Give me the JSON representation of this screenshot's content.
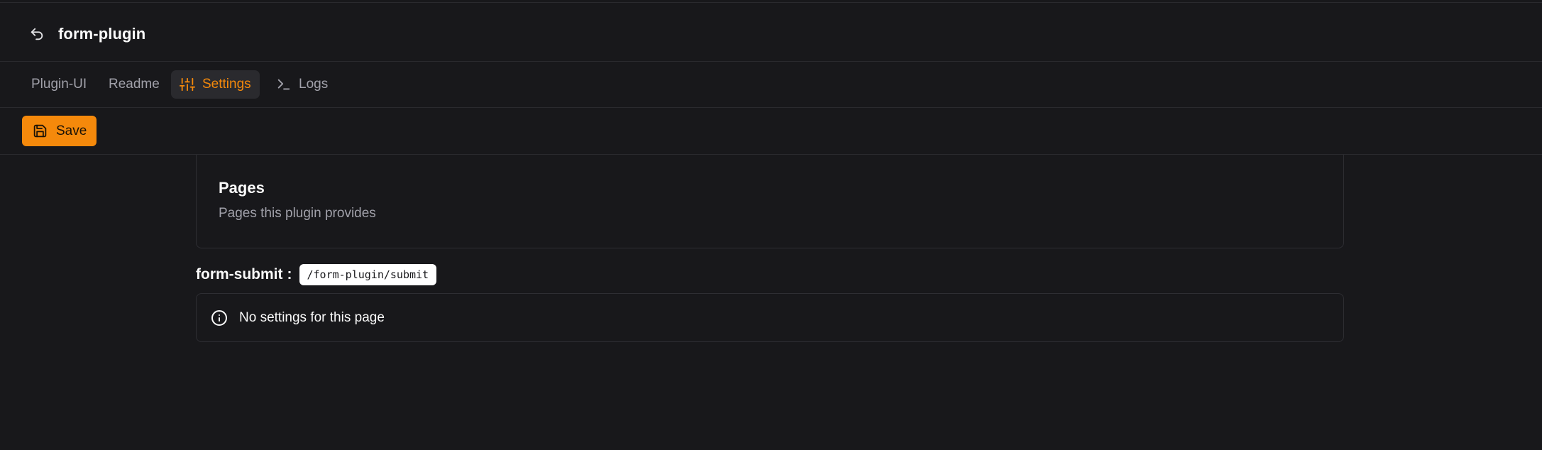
{
  "app": {
    "title": "form-plugin"
  },
  "tabs": [
    {
      "label": "Plugin-UI",
      "icon": "none"
    },
    {
      "label": "Readme",
      "icon": "none"
    },
    {
      "label": "Settings",
      "icon": "sliders-icon",
      "active": true
    },
    {
      "label": "Logs",
      "icon": "terminal-icon"
    }
  ],
  "toolbar": {
    "save_label": "Save",
    "save_icon": "save-icon"
  },
  "pages_section": {
    "title": "Pages",
    "description": "Pages this plugin provides"
  },
  "pages": [
    {
      "name": "form-submit",
      "separator": ":",
      "route": "/form-plugin/submit",
      "alert": {
        "icon": "info-icon",
        "text": "No settings for this page"
      }
    }
  ],
  "colors": {
    "background": "#18181b",
    "accent": "#f5890b",
    "muted_text": "#a1a1aa",
    "border": "#2e2e33"
  }
}
